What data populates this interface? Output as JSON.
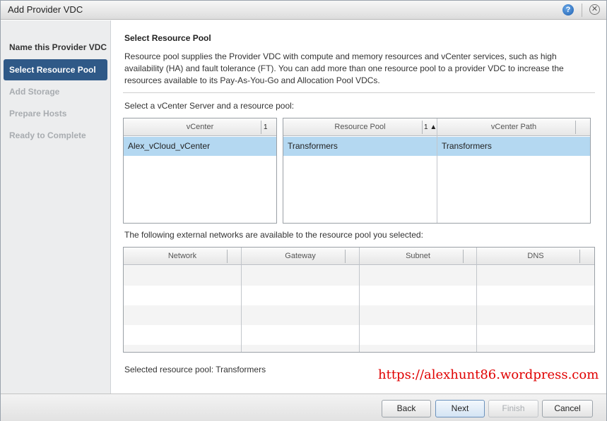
{
  "dialog": {
    "title": "Add Provider VDC",
    "help_glyph": "?",
    "close_glyph": "✕"
  },
  "steps": [
    {
      "label": "Name this Provider VDC",
      "state": "done"
    },
    {
      "label": "Select Resource Pool",
      "state": "active"
    },
    {
      "label": "Add Storage",
      "state": "todo"
    },
    {
      "label": "Prepare Hosts",
      "state": "todo"
    },
    {
      "label": "Ready to Complete",
      "state": "todo"
    }
  ],
  "page": {
    "heading": "Select Resource Pool",
    "description": "Resource pool supplies the Provider VDC with compute and memory resources and vCenter services, such as high availability (HA) and fault tolerance (FT). You can add more than one resource pool to a provider VDC to increase the resources available to its Pay-As-You-Go and Allocation Pool VDCs.",
    "vcenter_prompt": "Select a vCenter Server and a resource pool:",
    "networks_prompt": "The following external networks are available to the resource pool you selected:",
    "selected_summary": "Selected resource pool: Transformers"
  },
  "vcenter_grid": {
    "column": "vCenter",
    "sort_indicator": "1 ▲",
    "rows": [
      "Alex_vCloud_vCenter"
    ]
  },
  "pool_grid": {
    "columns": [
      "Resource Pool",
      "vCenter Path"
    ],
    "sort_indicator": "1 ▲",
    "rows": [
      {
        "pool": "Transformers",
        "path": "Transformers"
      }
    ]
  },
  "network_grid": {
    "columns": [
      "Network",
      "Gateway",
      "Subnet",
      "DNS"
    ],
    "rows": []
  },
  "buttons": {
    "back": "Back",
    "next": "Next",
    "finish": "Finish",
    "cancel": "Cancel"
  },
  "watermark": "https://alexhunt86.wordpress.com",
  "colors": {
    "active_step": "#2f5987",
    "selected_row": "#b4d8f1",
    "watermark": "#e00000"
  }
}
